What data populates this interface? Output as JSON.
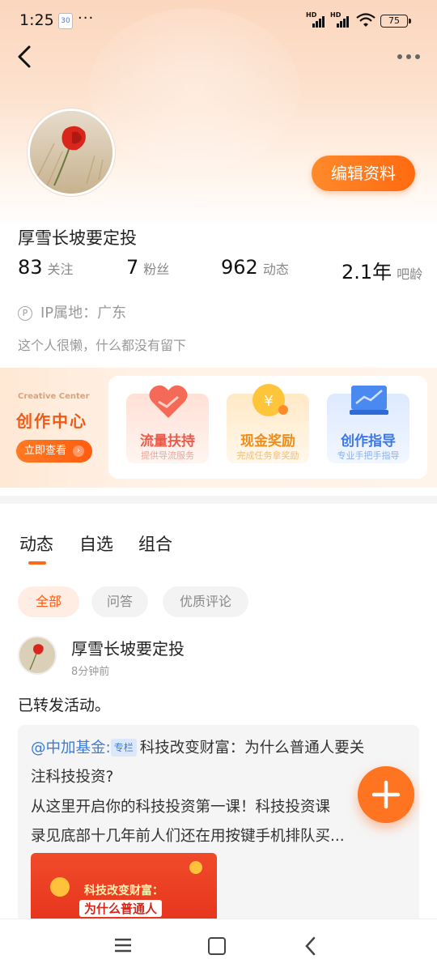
{
  "status_bar": {
    "time": "1:25",
    "calendar_badge": "30",
    "more_dots": "···",
    "signal_label": "HD",
    "battery": "75"
  },
  "profile": {
    "username": "厚雪长坡要定投",
    "edit_button": "编辑资料",
    "stats": [
      {
        "value": "83",
        "label": "关注"
      },
      {
        "value": "7",
        "label": "粉丝"
      },
      {
        "value": "962",
        "label": "动态"
      },
      {
        "value": "2.1年",
        "label": "吧龄"
      }
    ],
    "ip_icon": "P",
    "ip_location": "IP属地：广东",
    "bio": "这个人很懒，什么都没有留下"
  },
  "creative_center": {
    "title_en": "Creative Center",
    "title": "创作中心",
    "button": "立即查看",
    "cards": [
      {
        "title": "流量扶持",
        "subtitle": "提供导流服务",
        "icon": "handshake-heart-icon"
      },
      {
        "title": "现金奖励",
        "subtitle": "完成任务拿奖励",
        "icon": "coin-yuan-icon"
      },
      {
        "title": "创作指导",
        "subtitle": "专业手把手指导",
        "icon": "chart-monitor-icon"
      }
    ]
  },
  "tabs": [
    "动态",
    "自选",
    "组合"
  ],
  "filters": [
    "全部",
    "问答",
    "优质评论"
  ],
  "post": {
    "author": "厚雪长坡要定投",
    "time": "8分钟前",
    "text": "已转发活动。",
    "quote": {
      "user": "@中加基金:",
      "tag": "专栏",
      "line1": "科技改变财富：为什么普通人要关",
      "line2": "注科技投资?",
      "line3": "从这里开启你的科技投资第一课！科技投资课",
      "line4": "录见底部十几年前人们还在用按键手机排队买...",
      "thumb_line1": "科技改变财富：",
      "thumb_line2": "为什么普通人"
    }
  },
  "colors": {
    "accent": "#ff6a18",
    "link": "#3b7bd9"
  }
}
